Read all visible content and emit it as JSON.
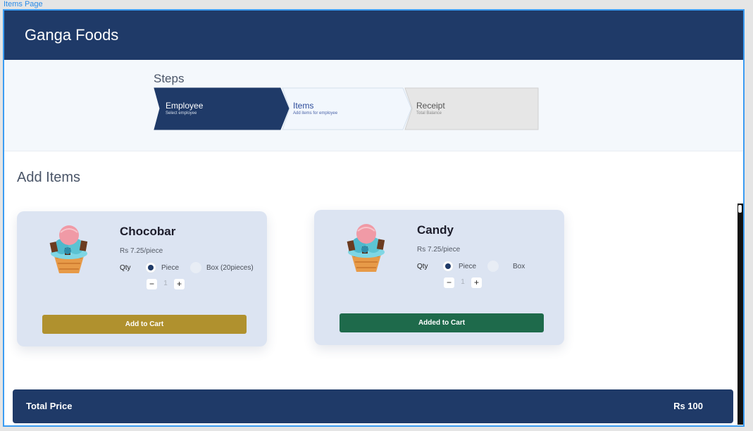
{
  "frame_label": "Items Page",
  "header": {
    "brand": "Ganga Foods"
  },
  "steps": {
    "title": "Steps",
    "items": [
      {
        "title": "Employee",
        "sub": "Select employee"
      },
      {
        "title": "Items",
        "sub": "Add items for employee"
      },
      {
        "title": "Receipt",
        "sub": "Total Balance"
      }
    ]
  },
  "section": {
    "title": "Add Items"
  },
  "products": [
    {
      "name": "Chocobar",
      "price": "Rs 7.25/piece",
      "qty_label": "Qty",
      "option_piece": "Piece",
      "option_box": "Box (20pieces)",
      "quantity": "1",
      "minus": "−",
      "plus": "+",
      "button": "Add to Cart"
    },
    {
      "name": "Candy",
      "price": "Rs 7.25/piece",
      "qty_label": "Qty",
      "option_piece": "Piece",
      "option_box": "Box",
      "quantity": "1",
      "minus": "−",
      "plus": "+",
      "button": "Added to Cart"
    }
  ],
  "total": {
    "label": "Total Price",
    "value": "Rs 100"
  },
  "colors": {
    "primary": "#1f3a68",
    "add_button": "#b0912e",
    "added_button": "#1e6a4b",
    "card_bg": "#dce4f2"
  },
  "icons": {
    "product_image": "ice-cream-cone-icon"
  }
}
